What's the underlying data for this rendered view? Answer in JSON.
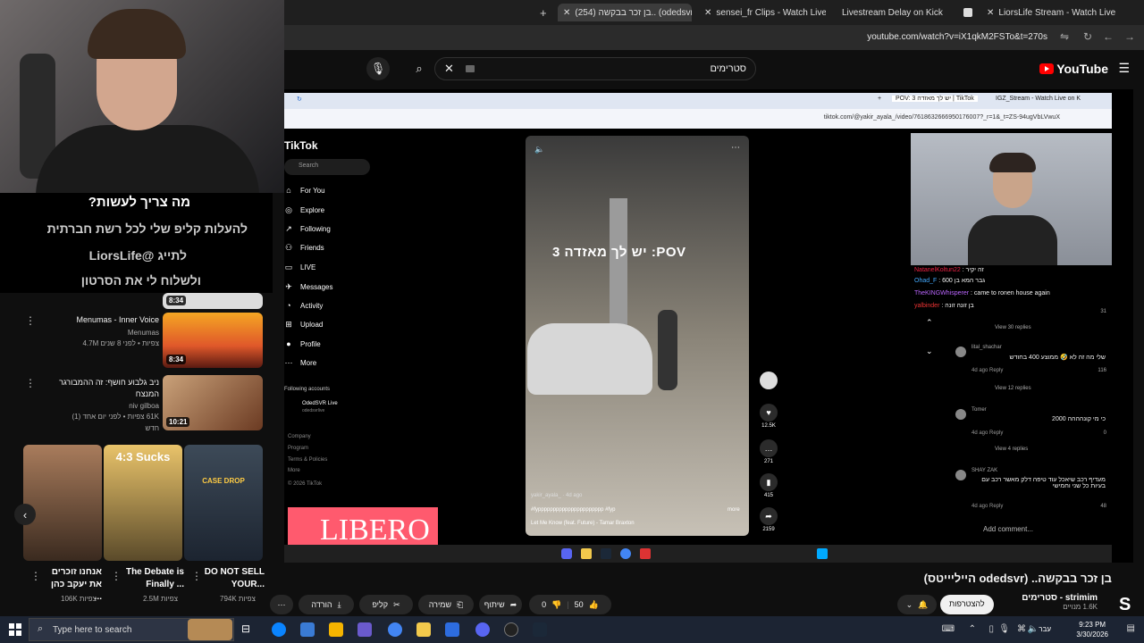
{
  "browser": {
    "tabs": [
      {
        "label": "(254) בן זכר בבקשה.. (odedsvr",
        "active": true
      },
      {
        "label": "sensei_fr Clips - Watch Live on"
      },
      {
        "label": "Livestream Delay on Kick"
      },
      {
        "label": "LiorsLife Stream - Watch Live on"
      }
    ],
    "url": "youtube.com/watch?v=iX1qkM2FSTo&t=270s"
  },
  "youtube": {
    "search_value": "סטרימים",
    "logo": "YouTube",
    "video_title": "בן זכר בבקשה.. (odedsvr הייליייטס)",
    "channel_name": "strimim - סטרימים",
    "subscribers": "1.6K מנויים",
    "subscribe_label": "להצטרפות",
    "likes": "50",
    "dislikes": "0",
    "share_label": "שיתוף",
    "save_label": "שמירה",
    "clip_label": "קליפ",
    "download_label": "הורדה"
  },
  "overlay": {
    "line1": "מה צריך לעשות?",
    "line2": "להעלות קליפ שלי לכל רשת חברתית",
    "line3": "לתייג @LiorsLife",
    "line4": "ולשלוח לי את הסרטון"
  },
  "recommendations": [
    {
      "title": "Menumas - Inner Voice",
      "channel": "Menumas",
      "views": "4.7M צפיות • לפני 8 שנים",
      "duration": "8:34"
    },
    {
      "title": "ניב גלבוע חושף: זה ההמבורגר המנצח",
      "channel": "niv gilboa",
      "views": "61K צפיות • לפני יום אחד (1)",
      "badge": "חדש",
      "duration": "10:21"
    }
  ],
  "top_partial_duration": "8:34",
  "shorts": [
    {
      "title": "אנחנו זוכרים את יעקב כהן ...",
      "views": "106K צפיות"
    },
    {
      "title": "The Debate is Finally ...",
      "views": "2.5M צפיות",
      "overlay_text": "4:3 Sucks"
    },
    {
      "title": "DO NOT SELL YOUR...",
      "views": "794K צפיות",
      "overlay_text": "CASE DROP"
    }
  ],
  "tiktok": {
    "inner_tabs": [
      "POV: 3 יש לך מאזדה | TikTok",
      "IGZ_Stream - Watch Live on K"
    ],
    "inner_url": "tiktok.com/@yakir_ayala_/video/7618632666950176007?_r=1&_t=ZS-94ugVbLVwuX",
    "logo": "TikTok",
    "search_placeholder": "Search",
    "nav": [
      "For You",
      "Explore",
      "Following",
      "Friends",
      "LIVE",
      "Messages",
      "Activity",
      "Upload",
      "Profile",
      "More"
    ],
    "following_header": "Following accounts",
    "following_name": "OdedSVR Live",
    "following_handle": "odedsvrlive",
    "footer": [
      "Company",
      "Program",
      "Terms & Policies",
      "More",
      "© 2026 TikTok"
    ],
    "pov_text": "יש לך מאזדה 3 :POV",
    "author": "yakir_ayala_ · 4d ago",
    "caption": "#fypppppppppppppppppppppp #fyp",
    "more": "more",
    "music": "Let Me Know (feat. Future) - Tamar Braxton",
    "likes": "12.5K",
    "comments": "271",
    "saves": "415",
    "shares": "2159",
    "add_comment": "Add comment...",
    "libero": "LIBERO"
  },
  "chat2": [
    {
      "user": "NatanelKoltun22",
      "msg": "זה יקיר",
      "color": "#e24"
    },
    {
      "user": "Ohad_F",
      "msg": "גבר המא בן 600",
      "color": "#4af"
    },
    {
      "user": "TheKINGWhisperer",
      "msg": "came to ronen house again",
      "color": "#b6f"
    },
    {
      "user": "yalbinder",
      "msg": "בן זונה זונה",
      "color": "#e33"
    }
  ],
  "comments": [
    {
      "name": "lital_shachar",
      "text": "שלי מה זה לא 🤣 ממוצע 400 בחודש",
      "meta": "4d ago   Reply",
      "likes": "116",
      "replies": "View 12 replies"
    },
    {
      "name": "Tomer",
      "text": "כי מי קונהההה 2000",
      "meta": "4d ago   Reply",
      "likes": "0",
      "replies": "View 4 replies"
    },
    {
      "name": "SHAY ZAK",
      "text": "מעדיף רכב שיאכל עוד טיפה דלק מאשר רכב עם בעיות כל שני וחמישי",
      "meta": "4d ago   Reply",
      "likes": "48"
    }
  ],
  "top_comment_meta": {
    "likes": "31",
    "replies": "View 30 replies"
  },
  "system": {
    "search_placeholder": "Type here to search",
    "time": "9:23 PM",
    "date": "3/30/2026",
    "lang": "עבר"
  }
}
